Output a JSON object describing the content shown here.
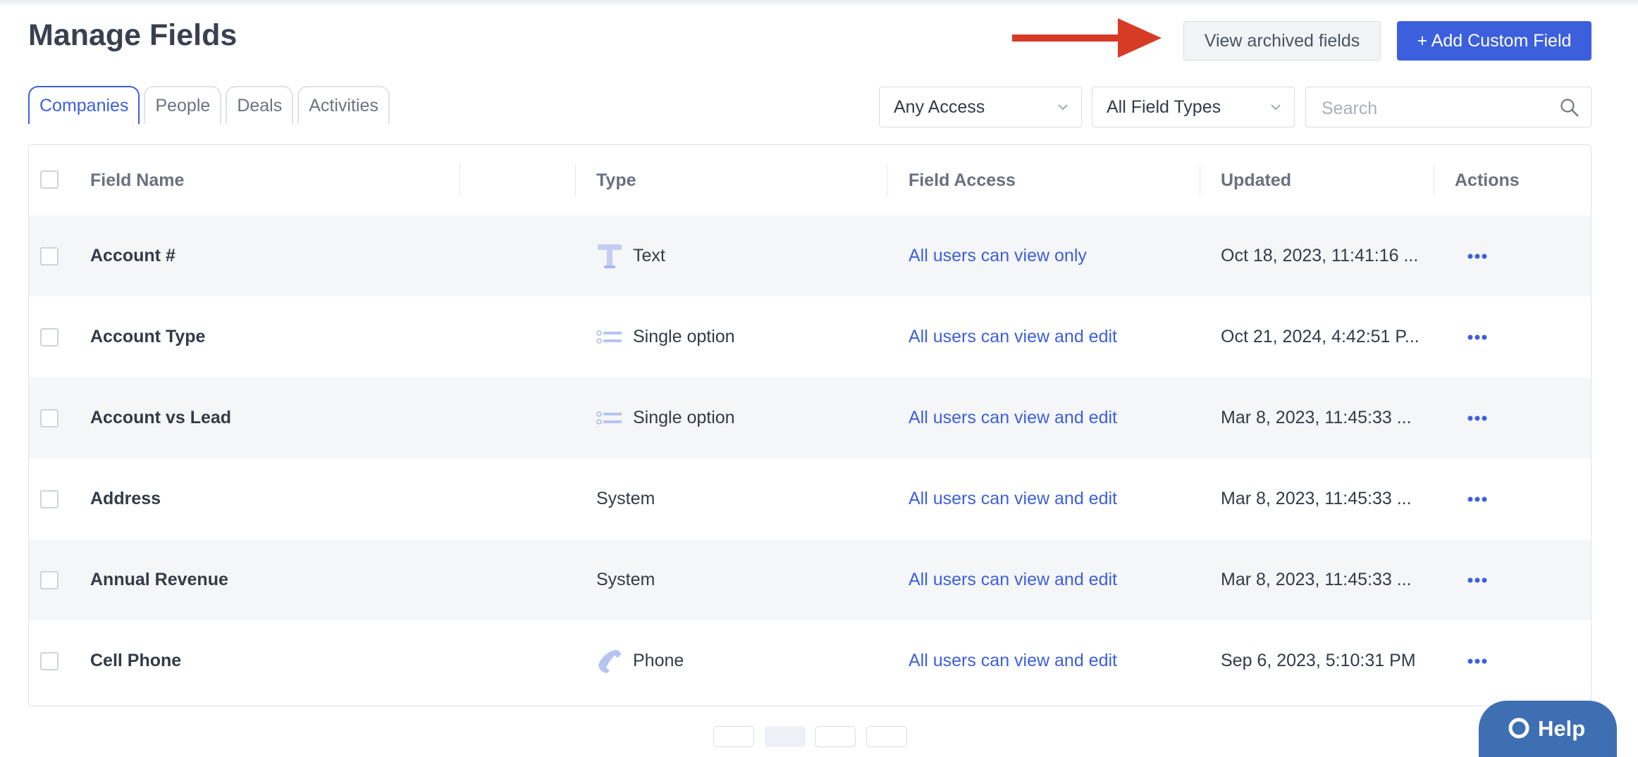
{
  "page": {
    "title": "Manage Fields"
  },
  "header": {
    "archived_label": "View archived fields",
    "add_label": "+ Add Custom Field"
  },
  "tabs": [
    {
      "label": "Companies",
      "active": true
    },
    {
      "label": "People"
    },
    {
      "label": "Deals"
    },
    {
      "label": "Activities"
    }
  ],
  "filters": {
    "access": "Any Access",
    "field_types": "All Field Types",
    "search_placeholder": "Search"
  },
  "table": {
    "columns": {
      "name": "Field Name",
      "type": "Type",
      "access": "Field Access",
      "updated": "Updated",
      "actions": "Actions"
    },
    "rows": [
      {
        "name": "Account #",
        "type": "Text",
        "type_icon": "text-icon",
        "access": "All users can view only",
        "updated": "Oct 18, 2023, 11:41:16 ..."
      },
      {
        "name": "Account Type",
        "type": "Single option",
        "type_icon": "list-icon",
        "access": "All users can view and edit",
        "updated": "Oct 21, 2024, 4:42:51 P..."
      },
      {
        "name": "Account vs Lead",
        "type": "Single option",
        "type_icon": "list-icon",
        "access": "All users can view and edit",
        "updated": "Mar 8, 2023, 11:45:33 ..."
      },
      {
        "name": "Address",
        "type": "System",
        "type_icon": "",
        "access": "All users can view and edit",
        "updated": "Mar 8, 2023, 11:45:33 ..."
      },
      {
        "name": "Annual Revenue",
        "type": "System",
        "type_icon": "",
        "access": "All users can view and edit",
        "updated": "Mar 8, 2023, 11:45:33 ..."
      },
      {
        "name": "Cell Phone",
        "type": "Phone",
        "type_icon": "phone-icon",
        "access": "All users can view and edit",
        "updated": "Sep 6, 2023, 5:10:31 PM"
      }
    ]
  },
  "help": {
    "label": "Help"
  },
  "colors": {
    "accent": "#3c5fde",
    "arrow": "#d63b26",
    "help": "#3f6fb3"
  }
}
